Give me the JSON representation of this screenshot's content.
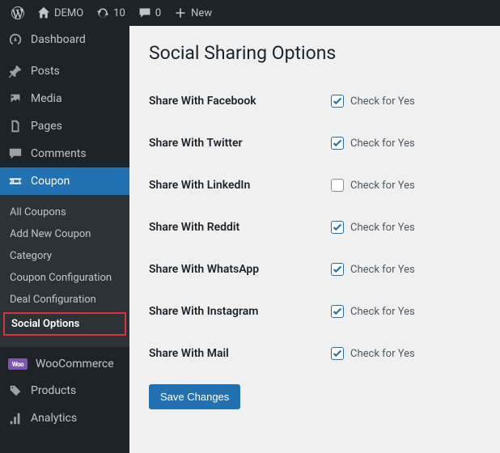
{
  "toolbar": {
    "site_name": "DEMO",
    "updates_count": "10",
    "comments_count": "0",
    "new_label": "New"
  },
  "sidebar": {
    "items": [
      {
        "label": "Dashboard"
      },
      {
        "label": "Posts"
      },
      {
        "label": "Media"
      },
      {
        "label": "Pages"
      },
      {
        "label": "Comments"
      },
      {
        "label": "Coupon"
      },
      {
        "label": "WooCommerce"
      },
      {
        "label": "Products"
      },
      {
        "label": "Analytics"
      }
    ],
    "submenu": [
      {
        "label": "All Coupons"
      },
      {
        "label": "Add New Coupon"
      },
      {
        "label": "Category"
      },
      {
        "label": "Coupon Configuration"
      },
      {
        "label": "Deal Configuration"
      },
      {
        "label": "Social Options"
      }
    ]
  },
  "page": {
    "title": "Social Sharing Options",
    "check_label": "Check for Yes",
    "save_button": "Save Changes",
    "options": [
      {
        "label": "Share With Facebook",
        "checked": true
      },
      {
        "label": "Share With Twitter",
        "checked": true
      },
      {
        "label": "Share With LinkedIn",
        "checked": false
      },
      {
        "label": "Share With Reddit",
        "checked": true
      },
      {
        "label": "Share With WhatsApp",
        "checked": true
      },
      {
        "label": "Share With Instagram",
        "checked": true
      },
      {
        "label": "Share With Mail",
        "checked": true
      }
    ]
  }
}
